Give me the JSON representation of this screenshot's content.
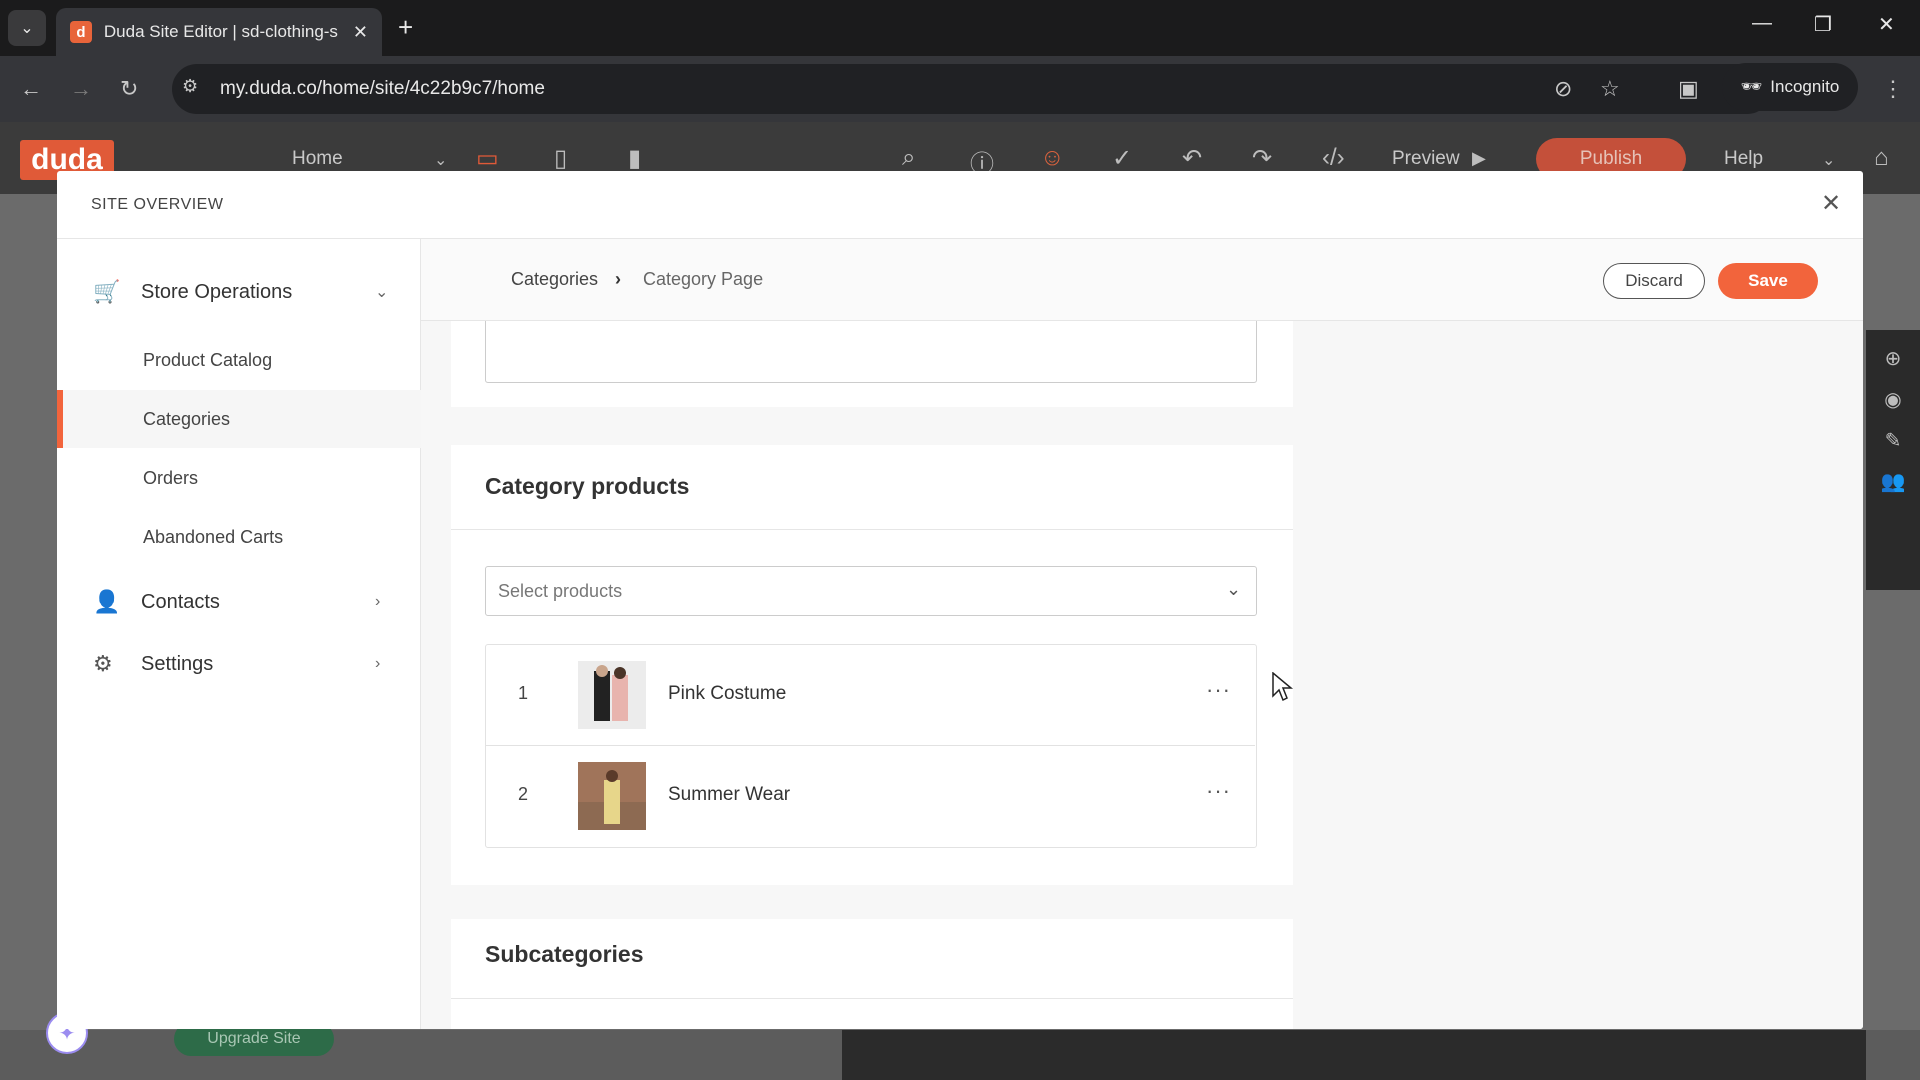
{
  "browser": {
    "tab_title": "Duda Site Editor | sd-clothing-s",
    "favicon_letter": "d",
    "url": "my.duda.co/home/site/4c22b9c7/home",
    "incognito_label": "Incognito"
  },
  "editor_toolbar": {
    "logo": "duda",
    "page_select": "Home",
    "preview_label": "Preview",
    "publish_label": "Publish",
    "help_label": "Help",
    "upgrade_label": "Upgrade Site"
  },
  "modal": {
    "title": "SITE OVERVIEW",
    "sidebar": {
      "store_operations": "Store Operations",
      "children": [
        "Product Catalog",
        "Categories",
        "Orders",
        "Abandoned Carts"
      ],
      "active_child": "Categories",
      "contacts": "Contacts",
      "settings": "Settings"
    },
    "breadcrumb": {
      "parent": "Categories",
      "current": "Category Page"
    },
    "actions": {
      "discard": "Discard",
      "save": "Save"
    },
    "category_products": {
      "title": "Category products",
      "select_placeholder": "Select products",
      "products": [
        {
          "index": "1",
          "name": "Pink Costume"
        },
        {
          "index": "2",
          "name": "Summer Wear"
        }
      ]
    },
    "subcategories": {
      "title": "Subcategories"
    }
  },
  "colors": {
    "accent": "#f2643c",
    "duda_brand": "#e05a38"
  }
}
